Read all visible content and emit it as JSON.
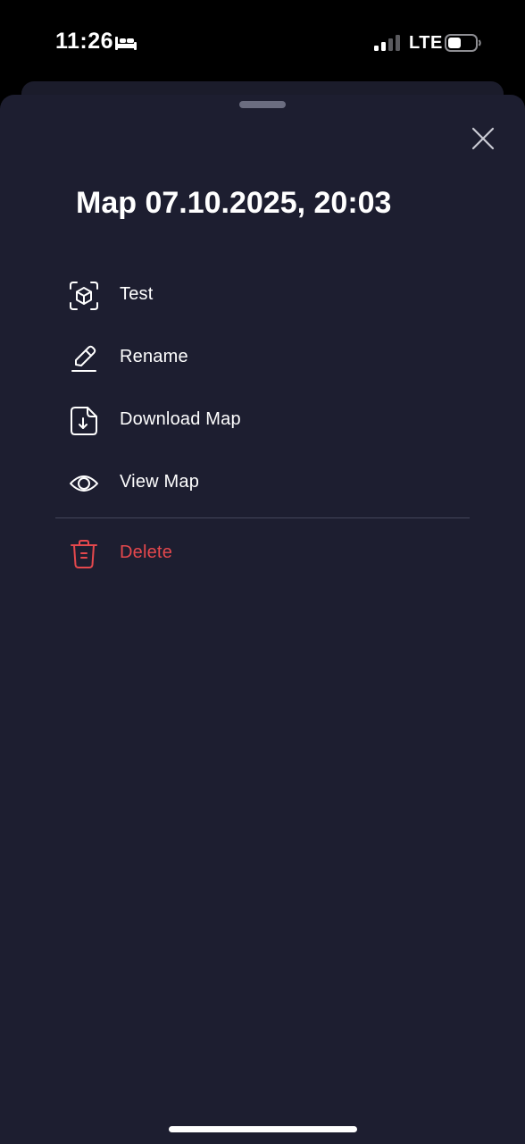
{
  "status_bar": {
    "time": "11:26",
    "network": "LTE",
    "icons": [
      "sleep-icon",
      "signal-icon",
      "battery-icon"
    ]
  },
  "sheet": {
    "title": "Map 07.10.2025, 20:03",
    "close_icon": "close-icon",
    "menu": [
      {
        "label": "Test",
        "icon": "cube-icon"
      },
      {
        "label": "Rename",
        "icon": "pencil-icon"
      },
      {
        "label": "Download Map",
        "icon": "download-file-icon"
      },
      {
        "label": "View Map",
        "icon": "eye-icon"
      }
    ],
    "delete": {
      "label": "Delete",
      "icon": "trash-icon"
    }
  },
  "colors": {
    "background": "#000000",
    "sheet": "#1d1e30",
    "text": "#ffffff",
    "danger": "#e5484d",
    "divider": "#44465a"
  }
}
